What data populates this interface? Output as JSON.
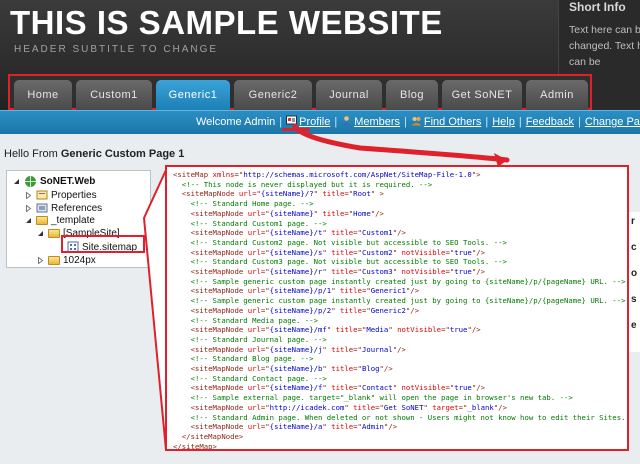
{
  "header": {
    "title": "THIS IS SAMPLE WEBSITE",
    "subtitle": "HEADER SUBTITLE TO CHANGE",
    "short_info_title": "Short Info",
    "short_info_text": "Text here can be changed. Text here can be"
  },
  "nav": {
    "tabs": [
      {
        "label": "Home"
      },
      {
        "label": "Custom1"
      },
      {
        "label": "Generic1",
        "active": true
      },
      {
        "label": "Generic2"
      },
      {
        "label": "Journal"
      },
      {
        "label": "Blog"
      },
      {
        "label": "Get SoNET"
      },
      {
        "label": "Admin"
      }
    ]
  },
  "userbar": {
    "welcome": "Welcome Admin",
    "profile": "Profile",
    "members": "Members",
    "find_others": "Find Others",
    "help": "Help",
    "feedback": "Feedback",
    "change_password": "Change Passw"
  },
  "main": {
    "hello_prefix": "Hello From",
    "hello_page": "Generic Custom Page 1"
  },
  "tree": {
    "items": [
      {
        "label": "SoNET.Web"
      },
      {
        "label": "Properties"
      },
      {
        "label": "References"
      },
      {
        "label": "_template"
      },
      {
        "label": "[SampleSite]"
      },
      {
        "label": "Site.sitemap"
      },
      {
        "label": "1024px"
      }
    ]
  },
  "side_letters": [
    "r",
    "c",
    "o",
    "s",
    "e"
  ],
  "code": {
    "lines": [
      [
        [
          "tag",
          "<siteMap "
        ],
        [
          "attr",
          "xmlns"
        ],
        [
          "tag",
          "=\""
        ],
        [
          "val",
          "http://schemas.microsoft.com/AspNet/SiteMap-File-1.0"
        ],
        [
          "tag",
          "\">"
        ]
      ],
      [
        [
          "com",
          "  <!-- This node is never displayed but it is required. -->"
        ]
      ],
      [
        [
          "tag",
          "  <siteMapNode "
        ],
        [
          "attr",
          "url"
        ],
        [
          "tag",
          "=\""
        ],
        [
          "val",
          "{siteName}/?"
        ],
        [
          "tag",
          "\" "
        ],
        [
          "attr",
          "title"
        ],
        [
          "tag",
          "=\""
        ],
        [
          "val",
          "Root"
        ],
        [
          "tag",
          "\" >"
        ]
      ],
      [
        [
          "com",
          "    <!-- Standard Home page. -->"
        ]
      ],
      [
        [
          "tag",
          "    <siteMapNode "
        ],
        [
          "attr",
          "url"
        ],
        [
          "tag",
          "=\""
        ],
        [
          "val",
          "{siteName}"
        ],
        [
          "tag",
          "\" "
        ],
        [
          "attr",
          "title"
        ],
        [
          "tag",
          "=\""
        ],
        [
          "val",
          "Home"
        ],
        [
          "tag",
          "\"/>"
        ]
      ],
      [
        [
          "com",
          "    <!-- Standard Custom1 page. -->"
        ]
      ],
      [
        [
          "tag",
          "    <siteMapNode "
        ],
        [
          "attr",
          "url"
        ],
        [
          "tag",
          "=\""
        ],
        [
          "val",
          "{siteName}/t"
        ],
        [
          "tag",
          "\" "
        ],
        [
          "attr",
          "title"
        ],
        [
          "tag",
          "=\""
        ],
        [
          "val",
          "Custom1"
        ],
        [
          "tag",
          "\"/>"
        ]
      ],
      [
        [
          "com",
          "    <!-- Standard Custom2 page. Not visible but accessible to SEO Tools. -->"
        ]
      ],
      [
        [
          "tag",
          "    <siteMapNode "
        ],
        [
          "attr",
          "url"
        ],
        [
          "tag",
          "=\""
        ],
        [
          "val",
          "{siteName}/s"
        ],
        [
          "tag",
          "\" "
        ],
        [
          "attr",
          "title"
        ],
        [
          "tag",
          "=\""
        ],
        [
          "val",
          "Custom2"
        ],
        [
          "tag",
          "\" "
        ],
        [
          "attr",
          "notVisible"
        ],
        [
          "tag",
          "=\""
        ],
        [
          "val",
          "true"
        ],
        [
          "tag",
          "\"/>"
        ]
      ],
      [
        [
          "com",
          "    <!-- Standard Custom3 page. Not visible but accessible to SEO Tools. -->"
        ]
      ],
      [
        [
          "tag",
          "    <siteMapNode "
        ],
        [
          "attr",
          "url"
        ],
        [
          "tag",
          "=\""
        ],
        [
          "val",
          "{siteName}/r"
        ],
        [
          "tag",
          "\" "
        ],
        [
          "attr",
          "title"
        ],
        [
          "tag",
          "=\""
        ],
        [
          "val",
          "Custom3"
        ],
        [
          "tag",
          "\" "
        ],
        [
          "attr",
          "notVisible"
        ],
        [
          "tag",
          "=\""
        ],
        [
          "val",
          "true"
        ],
        [
          "tag",
          "\"/>"
        ]
      ],
      [
        [
          "com",
          "    <!-- Sample generic custom page instantly created just by going to {siteName}/p/{pageName} URL. -->"
        ]
      ],
      [
        [
          "tag",
          "    <siteMapNode "
        ],
        [
          "attr",
          "url"
        ],
        [
          "tag",
          "=\""
        ],
        [
          "val",
          "{siteName}/p/1"
        ],
        [
          "tag",
          "\" "
        ],
        [
          "attr",
          "title"
        ],
        [
          "tag",
          "=\""
        ],
        [
          "val",
          "Generic1"
        ],
        [
          "tag",
          "\"/>"
        ]
      ],
      [
        [
          "com",
          "    <!-- Sample generic custom page instantly created just by going to {siteName}/p/{pageName} URL. -->"
        ]
      ],
      [
        [
          "tag",
          "    <siteMapNode "
        ],
        [
          "attr",
          "url"
        ],
        [
          "tag",
          "=\""
        ],
        [
          "val",
          "{siteName}/p/2"
        ],
        [
          "tag",
          "\" "
        ],
        [
          "attr",
          "title"
        ],
        [
          "tag",
          "=\""
        ],
        [
          "val",
          "Generic2"
        ],
        [
          "tag",
          "\"/>"
        ]
      ],
      [
        [
          "com",
          "    <!-- Standard Media page. -->"
        ]
      ],
      [
        [
          "tag",
          "    <siteMapNode "
        ],
        [
          "attr",
          "url"
        ],
        [
          "tag",
          "=\""
        ],
        [
          "val",
          "{siteName}/mf"
        ],
        [
          "tag",
          "\" "
        ],
        [
          "attr",
          "title"
        ],
        [
          "tag",
          "=\""
        ],
        [
          "val",
          "Media"
        ],
        [
          "tag",
          "\" "
        ],
        [
          "attr",
          "notVisible"
        ],
        [
          "tag",
          "=\""
        ],
        [
          "val",
          "true"
        ],
        [
          "tag",
          "\"/>"
        ]
      ],
      [
        [
          "com",
          "    <!-- Standard Journal page. -->"
        ]
      ],
      [
        [
          "tag",
          "    <siteMapNode "
        ],
        [
          "attr",
          "url"
        ],
        [
          "tag",
          "=\""
        ],
        [
          "val",
          "{siteName}/j"
        ],
        [
          "tag",
          "\" "
        ],
        [
          "attr",
          "title"
        ],
        [
          "tag",
          "=\""
        ],
        [
          "val",
          "Journal"
        ],
        [
          "tag",
          "\"/>"
        ]
      ],
      [
        [
          "com",
          "    <!-- Standard Blog page. -->"
        ]
      ],
      [
        [
          "tag",
          "    <siteMapNode "
        ],
        [
          "attr",
          "url"
        ],
        [
          "tag",
          "=\""
        ],
        [
          "val",
          "{siteName}/b"
        ],
        [
          "tag",
          "\" "
        ],
        [
          "attr",
          "title"
        ],
        [
          "tag",
          "=\""
        ],
        [
          "val",
          "Blog"
        ],
        [
          "tag",
          "\"/>"
        ]
      ],
      [
        [
          "com",
          "    <!-- Standard Contact page. -->"
        ]
      ],
      [
        [
          "tag",
          "    <siteMapNode "
        ],
        [
          "attr",
          "url"
        ],
        [
          "tag",
          "=\""
        ],
        [
          "val",
          "{siteName}/f"
        ],
        [
          "tag",
          "\" "
        ],
        [
          "attr",
          "title"
        ],
        [
          "tag",
          "=\""
        ],
        [
          "val",
          "Contact"
        ],
        [
          "tag",
          "\" "
        ],
        [
          "attr",
          "notVisible"
        ],
        [
          "tag",
          "=\""
        ],
        [
          "val",
          "true"
        ],
        [
          "tag",
          "\"/>"
        ]
      ],
      [
        [
          "com",
          "    <!-- Sample external page. target=\"_blank\" will open the page in browser's new tab. -->"
        ]
      ],
      [
        [
          "tag",
          "    <siteMapNode "
        ],
        [
          "attr",
          "url"
        ],
        [
          "tag",
          "=\""
        ],
        [
          "val",
          "http://icadek.com"
        ],
        [
          "tag",
          "\" "
        ],
        [
          "attr",
          "title"
        ],
        [
          "tag",
          "=\""
        ],
        [
          "val",
          "Get SoNET"
        ],
        [
          "tag",
          "\" "
        ],
        [
          "attr",
          "target"
        ],
        [
          "tag",
          "=\""
        ],
        [
          "val",
          "_blank"
        ],
        [
          "tag",
          "\"/>"
        ]
      ],
      [
        [
          "com",
          "    <!-- Standard Admin page. When deleted or not shown - Users might not know how to edit their Sites. -->"
        ]
      ],
      [
        [
          "tag",
          "    <siteMapNode "
        ],
        [
          "attr",
          "url"
        ],
        [
          "tag",
          "=\""
        ],
        [
          "val",
          "{siteName}/a"
        ],
        [
          "tag",
          "\" "
        ],
        [
          "attr",
          "title"
        ],
        [
          "tag",
          "=\""
        ],
        [
          "val",
          "Admin"
        ],
        [
          "tag",
          "\"/>"
        ]
      ],
      [
        [
          "tag",
          "  </siteMapNode>"
        ]
      ],
      [
        [
          "tag",
          "</siteMap>"
        ]
      ]
    ]
  }
}
